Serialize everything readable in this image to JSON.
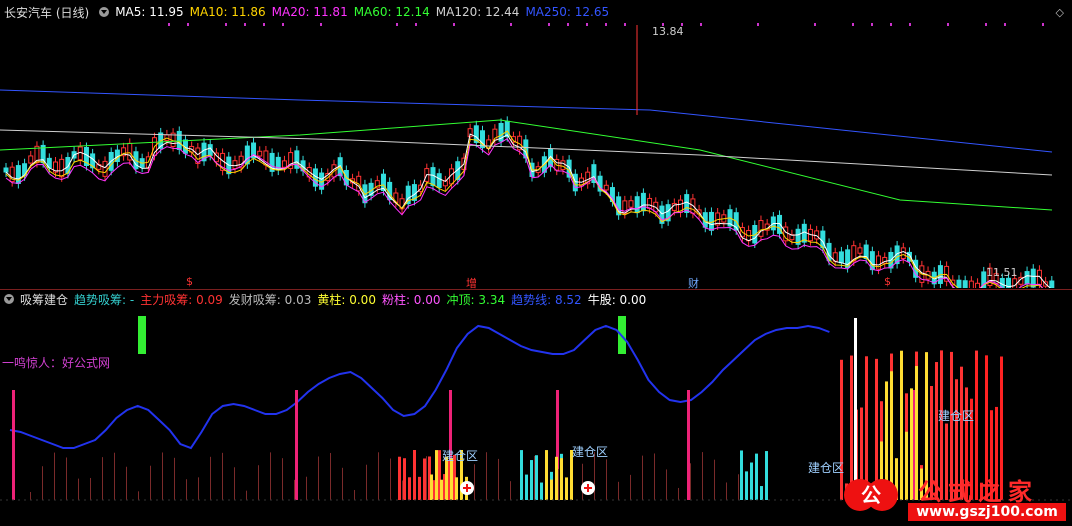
{
  "header": {
    "title": "长安汽车 (日线)",
    "ma": [
      {
        "label": "MA5: 11.95",
        "color": "#ffffff"
      },
      {
        "label": "MA10: 11.86",
        "color": "#ffd400"
      },
      {
        "label": "MA20: 11.81",
        "color": "#ff33ff"
      },
      {
        "label": "MA60: 12.14",
        "color": "#33ff33"
      },
      {
        "label": "MA120: 12.44",
        "color": "#d0d0d0"
      },
      {
        "label": "MA250: 12.65",
        "color": "#3355ff"
      }
    ]
  },
  "price_labels": {
    "high": "13.84",
    "low": "11.51"
  },
  "events": [
    {
      "label": "$",
      "color": "#ff3333"
    },
    {
      "label": "增",
      "color": "#ff3333"
    },
    {
      "label": "财",
      "color": "#6fa8ff"
    },
    {
      "label": "$",
      "color": "#ff3333"
    }
  ],
  "indicator": {
    "name": "吸筹建仓",
    "items": [
      {
        "label": "趋势吸筹: -",
        "color": "#33cccc"
      },
      {
        "label": "主力吸筹: 0.09",
        "color": "#ff3333"
      },
      {
        "label": "发财吸筹: 0.03",
        "color": "#bbbbbb"
      },
      {
        "label": "黄柱: 0.00",
        "color": "#ffff33"
      },
      {
        "label": "粉柱: 0.00",
        "color": "#ff55ff"
      },
      {
        "label": "冲顶: 3.34",
        "color": "#33ff33"
      },
      {
        "label": "趋势线: 8.52",
        "color": "#3355ff"
      },
      {
        "label": "牛股: 0.00",
        "color": "#ffffff"
      }
    ],
    "slogan": "一鸣惊人：好公式网",
    "zone_label": "建仓区"
  },
  "watermark": {
    "title": "公式之家",
    "url": "www.gszj100.com"
  },
  "colors": {
    "up": "#ff3333",
    "down": "#33dddd",
    "bg": "#000000"
  }
}
